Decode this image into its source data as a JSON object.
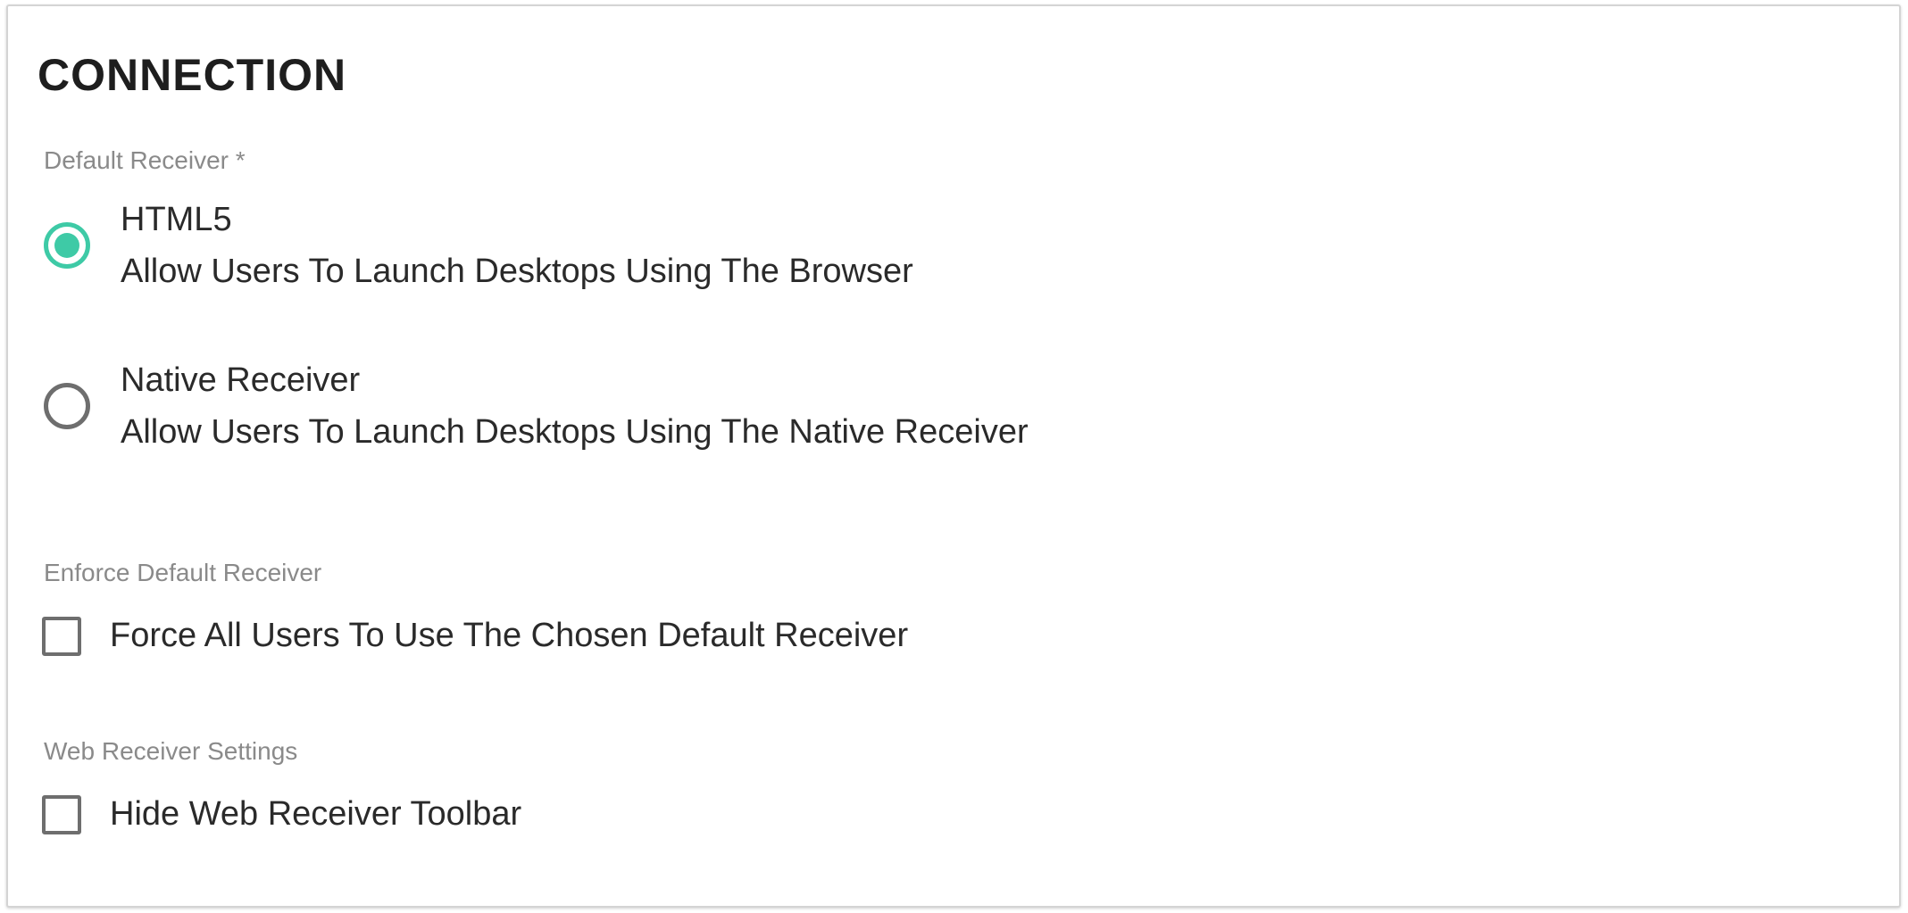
{
  "section": {
    "title": "CONNECTION"
  },
  "default_receiver": {
    "label": "Default Receiver *",
    "options": [
      {
        "title": "HTML5",
        "description": "Allow Users To Launch Desktops Using The Browser",
        "selected": true
      },
      {
        "title": "Native Receiver",
        "description": "Allow Users To Launch Desktops Using The Native Receiver",
        "selected": false
      }
    ]
  },
  "enforce_default_receiver": {
    "label": "Enforce Default Receiver",
    "checkbox_label": "Force All Users To Use The Chosen Default Receiver",
    "checked": false
  },
  "web_receiver_settings": {
    "label": "Web Receiver Settings",
    "checkbox_label": "Hide Web Receiver Toolbar",
    "checked": false
  },
  "colors": {
    "accent": "#3ecaa6",
    "control_border": "#6e6e6e",
    "label_gray": "#8a8a8a",
    "text": "#2a2a2a",
    "card_border": "#d4d4d4"
  },
  "icons": {
    "radio_selected": "radio-checked-icon",
    "radio_unselected": "radio-unchecked-icon",
    "checkbox_unchecked": "checkbox-unchecked-icon"
  }
}
